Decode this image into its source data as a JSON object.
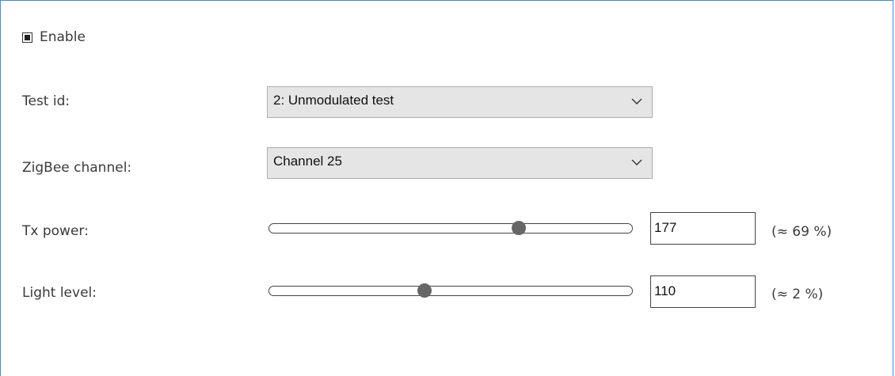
{
  "enable": {
    "label": "Enable",
    "checked": true
  },
  "test_id": {
    "label": "Test id:",
    "selected": "2: Unmodulated test"
  },
  "zigbee_channel": {
    "label": "ZigBee channel:",
    "selected": "Channel 25"
  },
  "tx_power": {
    "label": "Tx power:",
    "value": "177",
    "percent_label": "(≈ 69 %)",
    "slider_fraction": 0.69
  },
  "light_level": {
    "label": "Light level:",
    "value": "110",
    "percent_label": "(≈ 2 %)",
    "slider_fraction": 0.43
  },
  "colors": {
    "frame": "#3c8ee0",
    "select_bg": "#e5e5e5",
    "thumb": "#666666"
  },
  "icons": {
    "checkbox": "checked-checkbox-icon",
    "dropdown": "chevron-down-icon"
  }
}
